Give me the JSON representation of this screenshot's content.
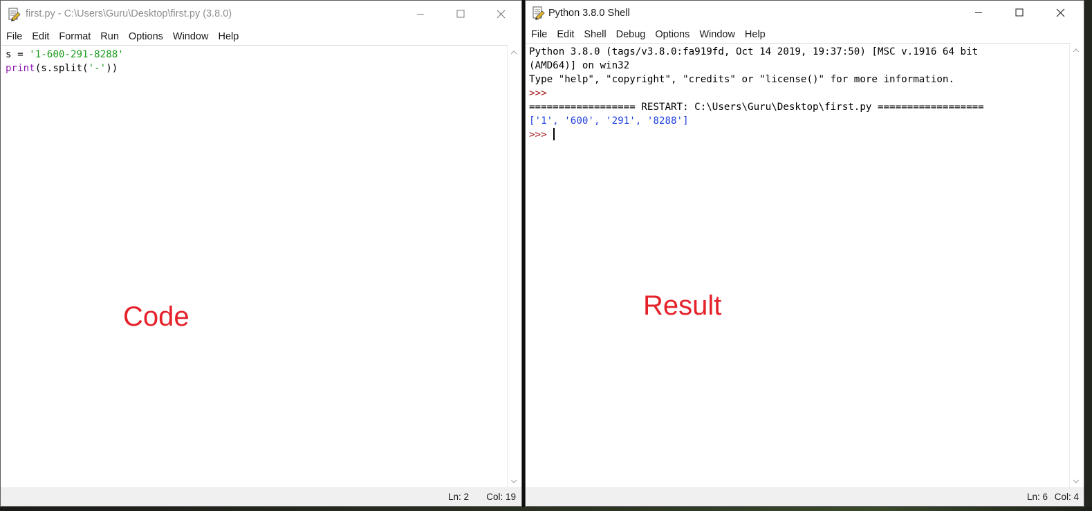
{
  "editor": {
    "title": "first.py - C:\\Users\\Guru\\Desktop\\first.py (3.8.0)",
    "menu": [
      "File",
      "Edit",
      "Format",
      "Run",
      "Options",
      "Window",
      "Help"
    ],
    "code_lines": [
      {
        "var": "s = ",
        "string": "'1-600-291-8288'"
      },
      {
        "func": "print",
        "rest_a": "(s.split(",
        "string": "'-'",
        "rest_b": "))"
      }
    ],
    "annotation": "Code",
    "status": {
      "ln": "Ln: 2",
      "col": "Col: 19"
    }
  },
  "shell": {
    "title": "Python 3.8.0 Shell",
    "menu": [
      "File",
      "Edit",
      "Shell",
      "Debug",
      "Options",
      "Window",
      "Help"
    ],
    "banner_1": "Python 3.8.0 (tags/v3.8.0:fa919fd, Oct 14 2019, 19:37:50) [MSC v.1916 64 bit",
    "banner_2": "(AMD64)] on win32",
    "banner_3": "Type \"help\", \"copyright\", \"credits\" or \"license()\" for more information.",
    "prompt": ">>>",
    "restart": "================== RESTART: C:\\Users\\Guru\\Desktop\\first.py ==================",
    "output": "['1', '600', '291', '8288']",
    "annotation": "Result",
    "status": {
      "ln": "Ln: 6",
      "col": "Col: 4"
    }
  },
  "icons": {
    "app": "idle-python-icon",
    "minimize": "minimize-icon",
    "maximize": "maximize-icon",
    "close": "close-icon",
    "scroll_up": "scroll-up-arrow-icon",
    "scroll_down": "scroll-down-arrow-icon"
  },
  "colors": {
    "keyword": "#8b1bb0",
    "string": "#1a9a1a",
    "prompt": "#a11414",
    "output": "#1f3fe0",
    "annotation": "#e5212a"
  }
}
